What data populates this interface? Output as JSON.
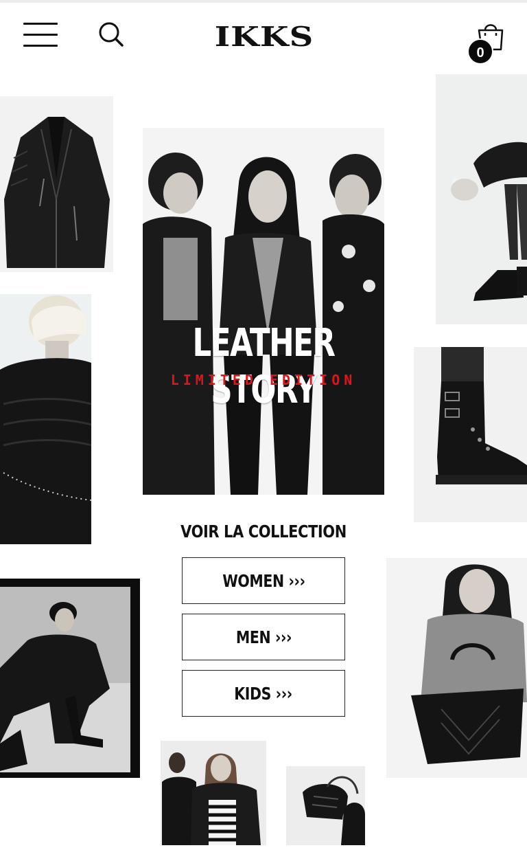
{
  "header": {
    "logo_text": "IKKS",
    "cart_count": "0"
  },
  "hero": {
    "title": "LEATHER STORY",
    "subtitle": "LIMITED EDITION",
    "subtitle_color": "#e0131a"
  },
  "collection": {
    "title": "VOIR LA COLLECTION",
    "buttons": [
      {
        "label": "WOMEN ›››"
      },
      {
        "label": "MEN ›››"
      },
      {
        "label": "KIDS ›››"
      }
    ]
  },
  "icons": [
    "hamburger-menu-icon",
    "search-icon",
    "shopping-bag-icon"
  ]
}
